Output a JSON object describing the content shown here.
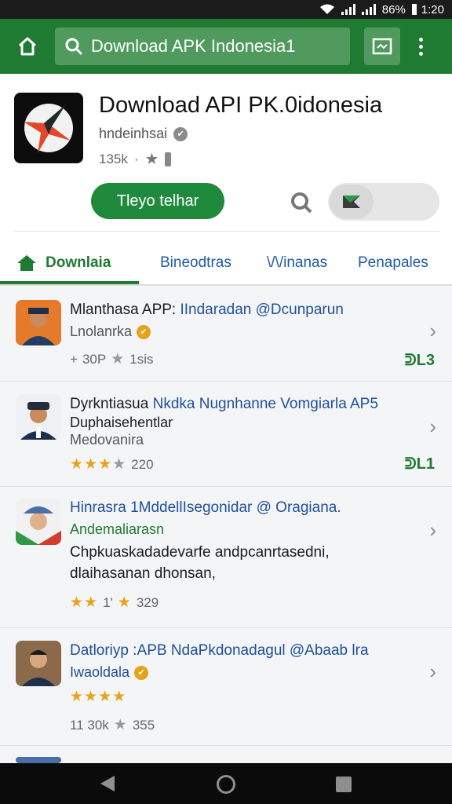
{
  "status_bar": {
    "battery": "86%",
    "time": "1:20"
  },
  "app_bar": {
    "search_text": "Download APK Indonesia1"
  },
  "app": {
    "title": "Download API PK.0idonesia",
    "developer": "hndeinhsai",
    "downloads": "135k",
    "install_label": "Tleyo telhar"
  },
  "tabs": [
    {
      "label": "Downlaia"
    },
    {
      "label": "Bineodtras"
    },
    {
      "label": "\\/\\/inanas"
    },
    {
      "label": "Penapales"
    }
  ],
  "items": [
    {
      "title_lead": "Mlanthasa APP:",
      "title_rest": "IIndaradan @Dcunparun",
      "subtitle": "Lnolanrka",
      "meta": "30P",
      "meta2": "1sis",
      "count": "L3"
    },
    {
      "title_lead": "Dyrkntiasua",
      "title_rest": "Nkdka Nugnhanne Vomgiarla AP5",
      "subtitle_bold": "Duphaisehentlar",
      "subtitle": "Medovanira",
      "rating_value": 3,
      "meta": "220",
      "count": "L1"
    },
    {
      "title": "Hinrasra 1MddellIsegonidar @ Oragiana.",
      "subtitle": "Andemaliarasn",
      "description": "Chpkuaskadadevarfe andpcanrtasedni, dlaihasanan dhonsan,",
      "rating_value": 2,
      "rating_label": "1'",
      "meta": "329"
    },
    {
      "title": "Datloriyp :APB NdaPkdonadagul @Abaab lra",
      "subtitle": "Iwaoldala",
      "rating_value": 4,
      "meta": "11 30k",
      "meta2": "355"
    }
  ],
  "colors": {
    "brand_green": "#1f7a32",
    "link_blue": "#1f5aa8",
    "star_gold": "#e8a317"
  }
}
